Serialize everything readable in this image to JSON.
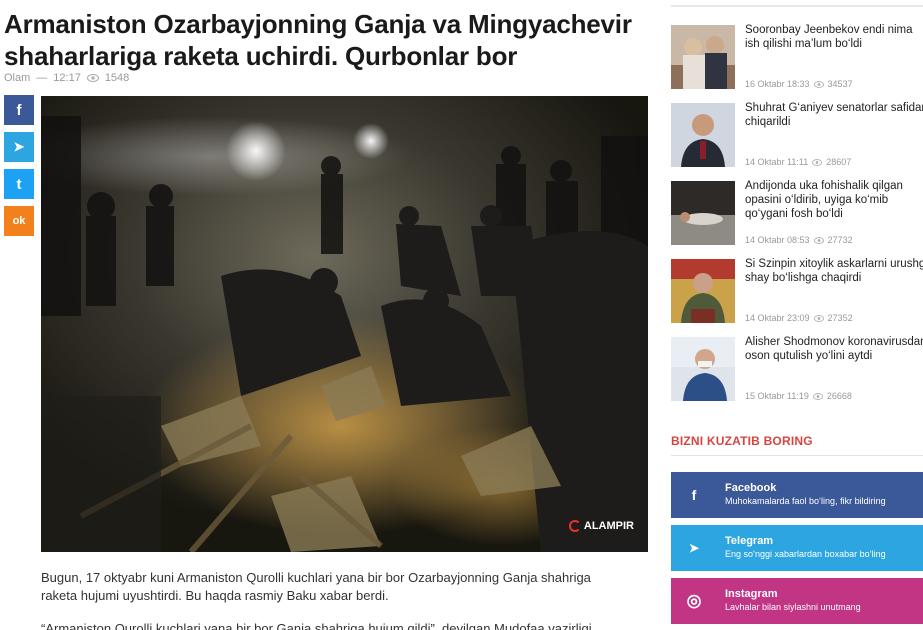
{
  "article": {
    "headline_line1": "Armaniston Ozarbayjonning Ganja va Mingyachevir",
    "headline_line2": "shaharlariga raketa uchirdi. Qurbonlar bor",
    "category": "Olam",
    "separator": "—",
    "time": "12:17",
    "views": "1548",
    "photo_watermark": "ALAMPIR",
    "paragraph1_line1": "Bugun, 17 oktyabr kuni Armaniston Qurolli kuchlari yana bir bor Ozarbayjonning Ganja shahriga",
    "paragraph1_line2": "raketa hujumi uyushtirdi. Bu haqda rasmiy Baku xabar berdi.",
    "paragraph2_partial": "“Armaniston Qurolli kuchlari yana bir bor Ganja shahriga hujum qildi”, deyilgan Mudofaa vazirligi"
  },
  "share": {
    "facebook_glyph": "f",
    "telegram_glyph": "➤",
    "twitter_glyph": "t",
    "odnoklassniki_glyph": "ok"
  },
  "sidebar": {
    "news": [
      {
        "title_line1": "Sooronbay Jeenbekov endi nima",
        "title_line2": "ish qilishi ma’lum bo‘ldi",
        "date": "16 Oktabr 18:33",
        "views": "34537"
      },
      {
        "title_line1": "Shuhrat G‘aniyev senatorlar safidan",
        "title_line2": "chiqarildi",
        "date": "14 Oktabr 11:11",
        "views": "28607"
      },
      {
        "title_line1": "Andijonda uka fohishalik qilgan",
        "title_line2": "opasini o‘ldirib, uyiga ko‘mib",
        "title_line3": "qo‘ygani fosh bo‘ldi",
        "date": "14 Oktabr 08:53",
        "views": "27732"
      },
      {
        "title_line1": "Si Szinpin xitoylik askarlarni urushga",
        "title_line2": "shay bo‘lishga chaqirdi",
        "date": "14 Oktabr 23:09",
        "views": "27352"
      },
      {
        "title_line1": "Alisher Shodmonov koronavirusdan",
        "title_line2": "oson qutulish yo‘lini aytdi",
        "date": "15 Oktabr 11:19",
        "views": "26668"
      }
    ],
    "follow_title": "BIZNI KUZATIB BORING",
    "social": [
      {
        "name": "Facebook",
        "desc": "Muhokamalarda faol bo‘ling, fikr bildiring",
        "glyph": "f"
      },
      {
        "name": "Telegram",
        "desc": "Eng so‘nggi xabarlardan boxabar bo‘ling",
        "glyph": "➤"
      },
      {
        "name": "Instagram",
        "desc": "Lavhalar bilan siylashni unutmang",
        "glyph": "◎"
      }
    ]
  },
  "colors": {
    "facebook": "#3b5998",
    "telegram": "#2ca5e0",
    "twitter": "#1da1f2",
    "odnoklassniki": "#f2811d",
    "instagram": "#c13584",
    "accent_red": "#d64541"
  }
}
